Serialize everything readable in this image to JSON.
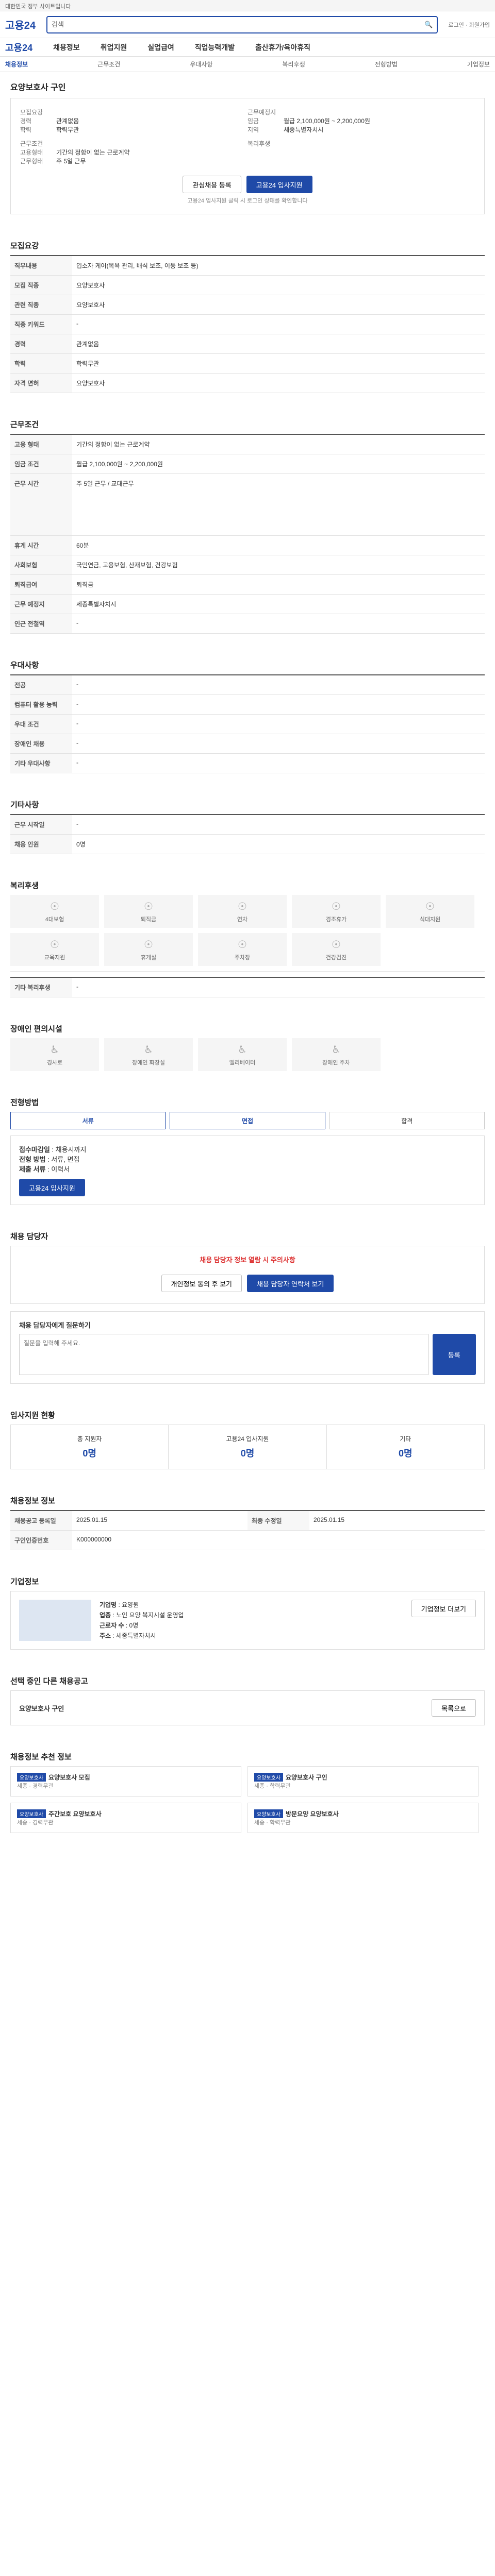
{
  "topbar": {
    "text": "대한민국 정부 사이트입니다"
  },
  "header": {
    "logo": "고용24",
    "search_placeholder": "검색",
    "right": "로그인 · 회원가입"
  },
  "nav": {
    "items": [
      "채용정보",
      "취업지원",
      "실업급여",
      "직업능력개발",
      "출산휴가/육아휴직"
    ]
  },
  "subnav": {
    "items": [
      "채용정보",
      "근무조건",
      "우대사항",
      "복리후생",
      "전형방법",
      "기업정보"
    ]
  },
  "job": {
    "title": "요양보호사 구인",
    "summary_left": [
      {
        "k": "모집요강",
        "v": ""
      },
      {
        "k": "경력",
        "v": "관계없음"
      },
      {
        "k": "학력",
        "v": "학력무관"
      },
      {
        "k": "근무조건",
        "v": ""
      },
      {
        "k": "고용형태",
        "v": "기간의 정함이 없는 근로계약"
      },
      {
        "k": "근무형태",
        "v": "주 5일 근무"
      }
    ],
    "summary_right": [
      {
        "k": "근무예정지",
        "v": ""
      },
      {
        "k": "임금",
        "v": "월급 2,100,000원 ~ 2,200,000원"
      },
      {
        "k": "지역",
        "v": "세종특별자치시"
      },
      {
        "k": "복리후생",
        "v": ""
      }
    ],
    "btn_scrap": "관심채용 등록",
    "btn_apply": "고용24 입사지원",
    "note": "고용24 입사지원 클릭 시 로그인 상태를 확인합니다"
  },
  "sec_recruit": {
    "title": "모집요강"
  },
  "recruit": [
    {
      "k": "직무내용",
      "v": "입소자 케어(목욕 관리, 배식 보조, 이동 보조 등)"
    },
    {
      "k": "모집 직종",
      "v": "요양보호사"
    },
    {
      "k": "관련 직종",
      "v": "요양보호사"
    },
    {
      "k": "직종 키워드",
      "v": "-"
    },
    {
      "k": "경력",
      "v": "관계없음"
    },
    {
      "k": "학력",
      "v": "학력무관"
    },
    {
      "k": "자격 면허",
      "v": "요양보호사"
    }
  ],
  "sec_cond": {
    "title": "근무조건"
  },
  "cond": [
    {
      "k": "고용 형태",
      "v": "기간의 정함이 없는 근로계약"
    },
    {
      "k": "임금 조건",
      "v": "월급 2,100,000원 ~ 2,200,000원"
    },
    {
      "k": "근무 시간",
      "v": "주 5일 근무 / 교대근무"
    },
    {
      "k": "휴게 시간",
      "v": "60분"
    },
    {
      "k": "사회보험",
      "v": "국민연금, 고용보험, 산재보험, 건강보험"
    },
    {
      "k": "퇴직급여",
      "v": "퇴직금"
    },
    {
      "k": "근무 예정지",
      "v": "세종특별자치시"
    },
    {
      "k": "인근 전철역",
      "v": "-"
    }
  ],
  "sec_pref": {
    "title": "우대사항"
  },
  "pref": [
    {
      "k": "전공",
      "v": "-"
    },
    {
      "k": "컴퓨터 활용 능력",
      "v": "-"
    },
    {
      "k": "우대 조건",
      "v": "-"
    },
    {
      "k": "장애인 채용",
      "v": "-"
    },
    {
      "k": "기타 우대사항",
      "v": "-"
    }
  ],
  "sec_etc": {
    "title": "기타사항"
  },
  "etc": [
    {
      "k": "근무 시작일",
      "v": "-"
    },
    {
      "k": "채용 인원",
      "v": "0명"
    }
  ],
  "sec_welfare": {
    "title": "복리후생"
  },
  "welfare_icons": [
    "4대보험",
    "퇴직금",
    "연차",
    "경조휴가",
    "식대지원",
    "교육지원",
    "휴게실",
    "주차장",
    "건강검진"
  ],
  "welfare_etc": {
    "k": "기타 복리후생",
    "v": "-"
  },
  "sec_disab": {
    "title": "장애인 편의시설"
  },
  "disab_icons": [
    "경사로",
    "장애인 화장실",
    "엘리베이터",
    "장애인 주차"
  ],
  "sec_apply": {
    "title": "전형방법"
  },
  "apply_steps": [
    "서류",
    "면접",
    "합격"
  ],
  "apply_info": [
    {
      "k": "접수마감일",
      "v": "채용시까지"
    },
    {
      "k": "전형 방법",
      "v": "서류, 면접"
    },
    {
      "k": "제출 서류",
      "v": "이력서"
    }
  ],
  "apply_btn": "고용24 입사지원",
  "sec_contact": {
    "title": "채용 담당자"
  },
  "contact": {
    "notice": "채용 담당자 정보 열람 시 주의사항",
    "btn1": "개인정보 동의 후 보기",
    "btn2": "채용 담당자 연락처 보기"
  },
  "inquiry": {
    "title": "채용 담당자에게 질문하기",
    "placeholder": "질문을 입력해 주세요.",
    "btn": "등록"
  },
  "sec_stats": {
    "title": "입사지원 현황"
  },
  "stats": [
    {
      "k": "총 지원자",
      "v": "0명"
    },
    {
      "k": "고용24 입사지원",
      "v": "0명"
    },
    {
      "k": "기타",
      "v": "0명"
    }
  ],
  "sec_info": {
    "title": "채용정보 정보"
  },
  "info": [
    {
      "k": "채용공고 등록일",
      "v": "2025.01.15"
    },
    {
      "k": "최종 수정일",
      "v": "2025.01.15"
    },
    {
      "k": "구인인증번호",
      "v": "K000000000"
    }
  ],
  "sec_company": {
    "title": "기업정보"
  },
  "company": [
    {
      "k": "기업명",
      "v": "요양원"
    },
    {
      "k": "업종",
      "v": "노인 요양 복지시설 운영업"
    },
    {
      "k": "근로자 수",
      "v": "0명"
    },
    {
      "k": "주소",
      "v": "세종특별자치시"
    }
  ],
  "company_btn": "기업정보 더보기",
  "sec_similar": {
    "title": "선택 중인 다른 채용공고"
  },
  "similar": {
    "title": "요양보호사 구인",
    "btn": "목록으로"
  },
  "sec_rec": {
    "title": "채용정보 추천 정보"
  },
  "rec_cards": [
    {
      "tag": "요양보호사",
      "title": "요양보호사 모집",
      "meta": "세종 · 경력무관"
    },
    {
      "tag": "요양보호사",
      "title": "요양보호사 구인",
      "meta": "세종 · 학력무관"
    },
    {
      "tag": "요양보호사",
      "title": "주간보호 요양보호사",
      "meta": "세종 · 경력무관"
    },
    {
      "tag": "요양보호사",
      "title": "방문요양 요양보호사",
      "meta": "세종 · 학력무관"
    }
  ]
}
